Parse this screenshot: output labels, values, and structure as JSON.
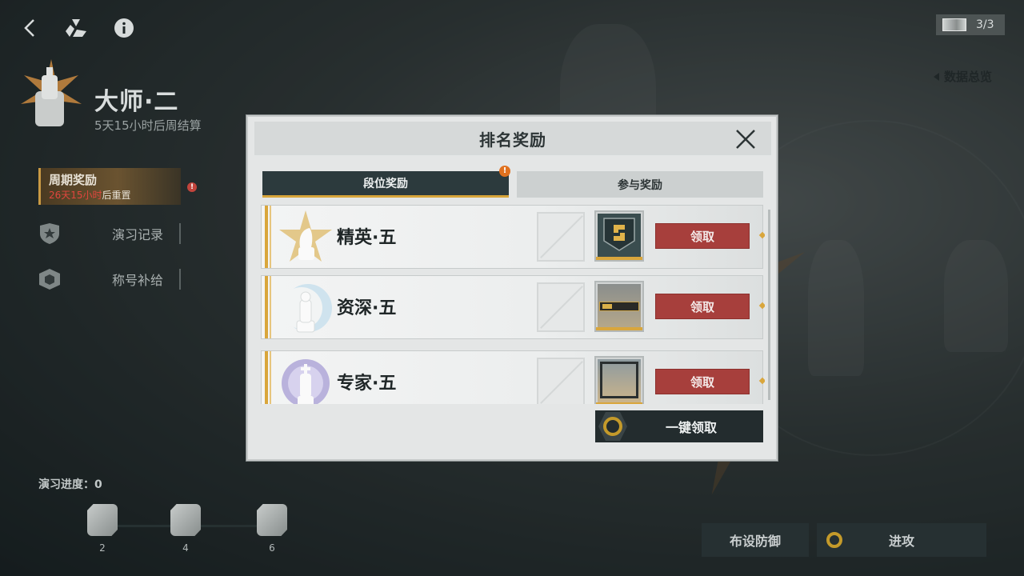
{
  "top_bar": {
    "ticket_count": "3/3",
    "data_overview_label": "数据总览"
  },
  "rank": {
    "title": "大师·二",
    "subtitle": "5天15小时后周结算"
  },
  "left_menu": {
    "period_reward_title": "周期奖励",
    "period_reward_time": "26天15小时",
    "period_reward_suffix": "后重置",
    "items": [
      {
        "label": "演习记录",
        "icon": "shield-icon"
      },
      {
        "label": "称号补给",
        "icon": "supply-box-icon"
      }
    ]
  },
  "progress": {
    "label": "演习进度：0",
    "milestones": [
      "2",
      "4",
      "6"
    ]
  },
  "bottom_buttons": {
    "defense_label": "布设防御",
    "attack_label": "进攻"
  },
  "modal": {
    "title": "排名奖励",
    "tabs": [
      {
        "label": "段位奖励",
        "active": true,
        "badge": "!"
      },
      {
        "label": "参与奖励",
        "active": false
      }
    ],
    "rows": [
      {
        "tier": "精英·五",
        "item_icon": "badge-icon",
        "claim_label": "领取"
      },
      {
        "tier": "资深·五",
        "item_icon": "nameplate-icon",
        "claim_label": "领取"
      },
      {
        "tier": "专家·五",
        "item_icon": "avatar-frame-icon",
        "claim_label": "领取"
      }
    ],
    "claim_all_label": "一键领取"
  },
  "colors": {
    "accent_gold": "#d9a63c",
    "claim_red": "#a73f3c",
    "dark_panel": "#2c3a3d"
  }
}
